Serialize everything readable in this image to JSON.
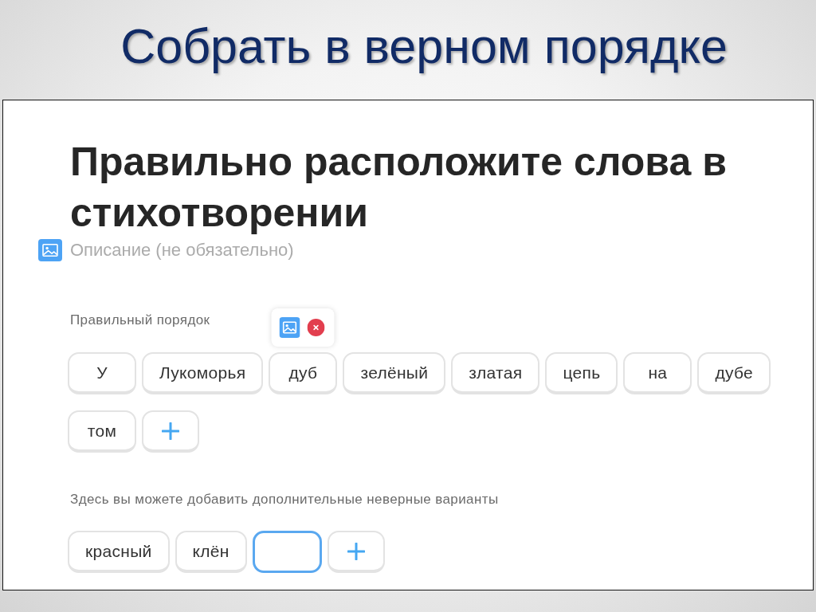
{
  "slide_title": "Собрать в верном порядке",
  "editor": {
    "question": "Правильно расположите слова в стихотворении",
    "description": {
      "placeholder": "Описание (не обязательно)"
    },
    "correct_order": {
      "label": "Правильный порядок",
      "words": [
        {
          "text": "У",
          "hovered": false
        },
        {
          "text": "Лукоморья",
          "hovered": false
        },
        {
          "text": "дуб",
          "hovered": true
        },
        {
          "text": "зелёный",
          "hovered": false
        },
        {
          "text": "златая",
          "hovered": false
        },
        {
          "text": "цепь",
          "hovered": false
        },
        {
          "text": "на",
          "hovered": false
        },
        {
          "text": "дубе",
          "hovered": false
        },
        {
          "text": "том",
          "hovered": false
        }
      ],
      "add_button": true
    },
    "distractors": {
      "label": "Здесь вы можете добавить дополнительные неверные варианты",
      "words": [
        {
          "text": "красный",
          "hovered": false
        },
        {
          "text": "клён",
          "hovered": false
        }
      ],
      "new_word_input": {
        "focused": true
      },
      "add_button": true
    }
  }
}
